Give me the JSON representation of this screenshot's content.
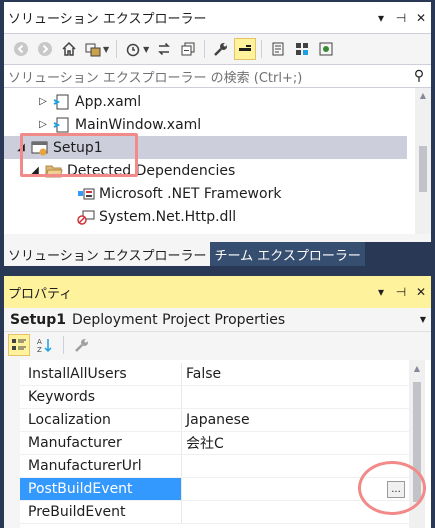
{
  "solution_explorer": {
    "title": "ソリューション エクスプローラー",
    "title_buttons": [
      "▾",
      "⊣",
      "✕"
    ],
    "search_placeholder": "ソリューション エクスプローラー の検索 (Ctrl+;)",
    "tree": [
      {
        "label": "App.xaml",
        "expander": "▷",
        "icon": "xaml-file-icon",
        "selected": false
      },
      {
        "label": "MainWindow.xaml",
        "expander": "▷",
        "icon": "xaml-file-icon",
        "selected": false
      },
      {
        "label": "Setup1",
        "expander": "◢",
        "icon": "setup-project-icon",
        "selected": true
      },
      {
        "label": "Detected Dependencies",
        "expander": "◢",
        "icon": "folder-icon",
        "selected": false
      },
      {
        "label": "Microsoft .NET Framework",
        "expander": "",
        "icon": "dotnet-framework-icon",
        "selected": false
      },
      {
        "label": "System.Net.Http.dll",
        "expander": "",
        "icon": "excluded-dll-icon",
        "selected": false
      }
    ],
    "tabs": [
      {
        "label": "ソリューション エクスプローラー",
        "active": true
      },
      {
        "label": "チーム エクスプローラー",
        "active": false
      }
    ]
  },
  "properties": {
    "title": "プロパティ",
    "title_buttons": [
      "▾",
      "⊣",
      "✕"
    ],
    "object_name": "Setup1",
    "object_type": "Deployment Project Properties",
    "rows": [
      {
        "name": "InstallAllUsers",
        "value": "False",
        "selected": false
      },
      {
        "name": "Keywords",
        "value": "",
        "selected": false
      },
      {
        "name": "Localization",
        "value": "Japanese",
        "selected": false
      },
      {
        "name": "Manufacturer",
        "value": "会社C",
        "selected": false
      },
      {
        "name": "ManufacturerUrl",
        "value": "",
        "selected": false
      },
      {
        "name": "PostBuildEvent",
        "value": "",
        "selected": true
      },
      {
        "name": "PreBuildEvent",
        "value": "",
        "selected": false
      }
    ],
    "ellipsis_label": "..."
  },
  "colors": {
    "background": "#293955",
    "selection_tree": "#cccedb",
    "selection_grid": "#3399ff",
    "active_title": "#fff29d",
    "annotation": "#f28a8a"
  }
}
